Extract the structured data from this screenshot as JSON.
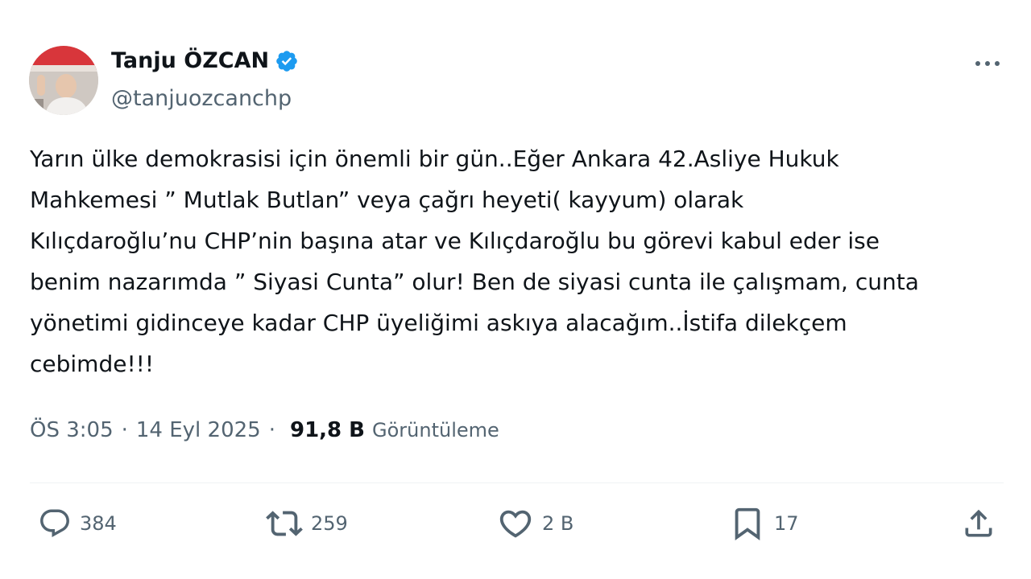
{
  "author": {
    "display_name": "Tanju ÖZCAN",
    "handle": "@tanjuozcanchp",
    "verified_icon": "verified-badge-icon"
  },
  "tweet": {
    "lines": [
      "Yarın ülke demokrasisi için önemli bir gün..Eğer Ankara 42.Asliye Hukuk",
      "Mahkemesi ” Mutlak Butlan” veya çağrı heyeti( kayyum) olarak",
      "Kılıçdaroğlu’nu CHP’nin başına atar ve Kılıçdaroğlu bu görevi kabul eder ise",
      "benim nazarımda ” Siyasi Cunta” olur! Ben de siyasi cunta ile çalışmam, cunta",
      "yönetimi gidinceye kadar CHP üyeliğimi askıya alacağım..İstifa dilekçem",
      "cebimde!!!"
    ]
  },
  "meta": {
    "time": "ÖS 3:05",
    "separator": "·",
    "date": "14 Eyl 2025",
    "views": "91,8 B",
    "views_label": "Görüntüleme"
  },
  "actions": {
    "replies": "384",
    "reposts": "259",
    "likes": "2 B",
    "bookmarks": "17"
  },
  "colors": {
    "text": "#0f1419",
    "secondary": "#536471",
    "verified": "#1d9bf0",
    "divider": "#eff3f4"
  }
}
